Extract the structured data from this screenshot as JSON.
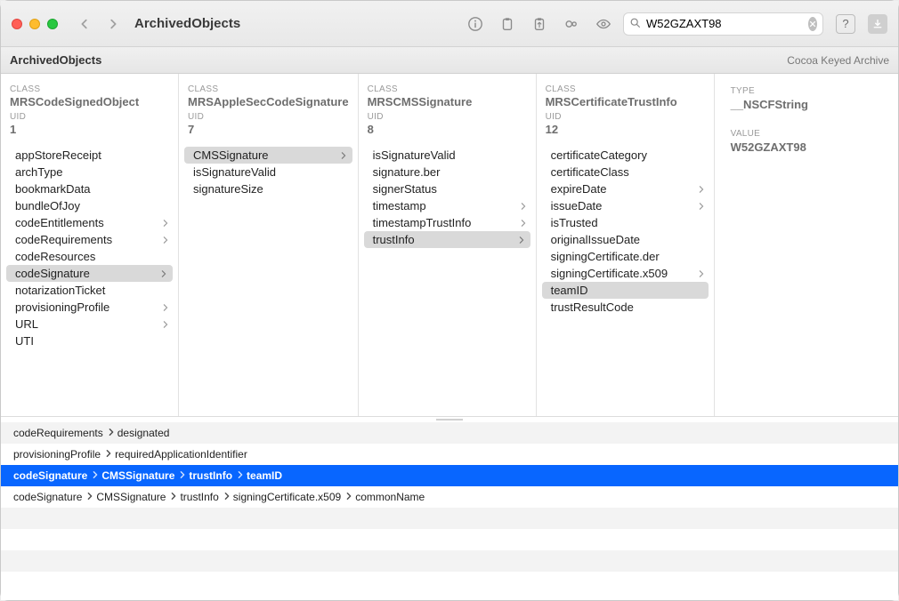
{
  "window": {
    "title": "ArchivedObjects"
  },
  "toolbar": {
    "search_value": "W52GZAXT98"
  },
  "subheader": {
    "breadcrumb": "ArchivedObjects",
    "archive_type": "Cocoa Keyed Archive"
  },
  "columns": [
    {
      "class_label": "CLASS",
      "class_value": "MRSCodeSignedObject",
      "uid_label": "UID",
      "uid_value": "1",
      "items": [
        {
          "label": "appStoreReceipt",
          "arrow": false,
          "selected": false
        },
        {
          "label": "archType",
          "arrow": false,
          "selected": false
        },
        {
          "label": "bookmarkData",
          "arrow": false,
          "selected": false
        },
        {
          "label": "bundleOfJoy",
          "arrow": false,
          "selected": false
        },
        {
          "label": "codeEntitlements",
          "arrow": true,
          "selected": false
        },
        {
          "label": "codeRequirements",
          "arrow": true,
          "selected": false
        },
        {
          "label": "codeResources",
          "arrow": false,
          "selected": false
        },
        {
          "label": "codeSignature",
          "arrow": true,
          "selected": true
        },
        {
          "label": "notarizationTicket",
          "arrow": false,
          "selected": false
        },
        {
          "label": "provisioningProfile",
          "arrow": true,
          "selected": false
        },
        {
          "label": "URL",
          "arrow": true,
          "selected": false
        },
        {
          "label": "UTI",
          "arrow": false,
          "selected": false
        }
      ]
    },
    {
      "class_label": "CLASS",
      "class_value": "MRSAppleSecCodeSignature",
      "uid_label": "UID",
      "uid_value": "7",
      "items": [
        {
          "label": "CMSSignature",
          "arrow": true,
          "selected": true
        },
        {
          "label": "isSignatureValid",
          "arrow": false,
          "selected": false
        },
        {
          "label": "signatureSize",
          "arrow": false,
          "selected": false
        }
      ]
    },
    {
      "class_label": "CLASS",
      "class_value": "MRSCMSSignature",
      "uid_label": "UID",
      "uid_value": "8",
      "items": [
        {
          "label": "isSignatureValid",
          "arrow": false,
          "selected": false
        },
        {
          "label": "signature.ber",
          "arrow": false,
          "selected": false
        },
        {
          "label": "signerStatus",
          "arrow": false,
          "selected": false
        },
        {
          "label": "timestamp",
          "arrow": true,
          "selected": false
        },
        {
          "label": "timestampTrustInfo",
          "arrow": true,
          "selected": false
        },
        {
          "label": "trustInfo",
          "arrow": true,
          "selected": true
        }
      ]
    },
    {
      "class_label": "CLASS",
      "class_value": "MRSCertificateTrustInfo",
      "uid_label": "UID",
      "uid_value": "12",
      "items": [
        {
          "label": "certificateCategory",
          "arrow": false,
          "selected": false
        },
        {
          "label": "certificateClass",
          "arrow": false,
          "selected": false
        },
        {
          "label": "expireDate",
          "arrow": true,
          "selected": false
        },
        {
          "label": "issueDate",
          "arrow": true,
          "selected": false
        },
        {
          "label": "isTrusted",
          "arrow": false,
          "selected": false
        },
        {
          "label": "originalIssueDate",
          "arrow": false,
          "selected": false
        },
        {
          "label": "signingCertificate.der",
          "arrow": false,
          "selected": false
        },
        {
          "label": "signingCertificate.x509",
          "arrow": true,
          "selected": false
        },
        {
          "label": "teamID",
          "arrow": false,
          "selected": true
        },
        {
          "label": "trustResultCode",
          "arrow": false,
          "selected": false
        }
      ]
    }
  ],
  "detail": {
    "type_label": "TYPE",
    "type_value": "__NSCFString",
    "value_label": "VALUE",
    "value_value": "W52GZAXT98"
  },
  "results": [
    {
      "segments": [
        "codeRequirements",
        "designated"
      ],
      "selected": false
    },
    {
      "segments": [
        "provisioningProfile",
        "requiredApplicationIdentifier"
      ],
      "selected": false
    },
    {
      "segments": [
        "codeSignature",
        "CMSSignature",
        "trustInfo",
        "teamID"
      ],
      "selected": true
    },
    {
      "segments": [
        "codeSignature",
        "CMSSignature",
        "trustInfo",
        "signingCertificate.x509",
        "commonName"
      ],
      "selected": false
    }
  ]
}
